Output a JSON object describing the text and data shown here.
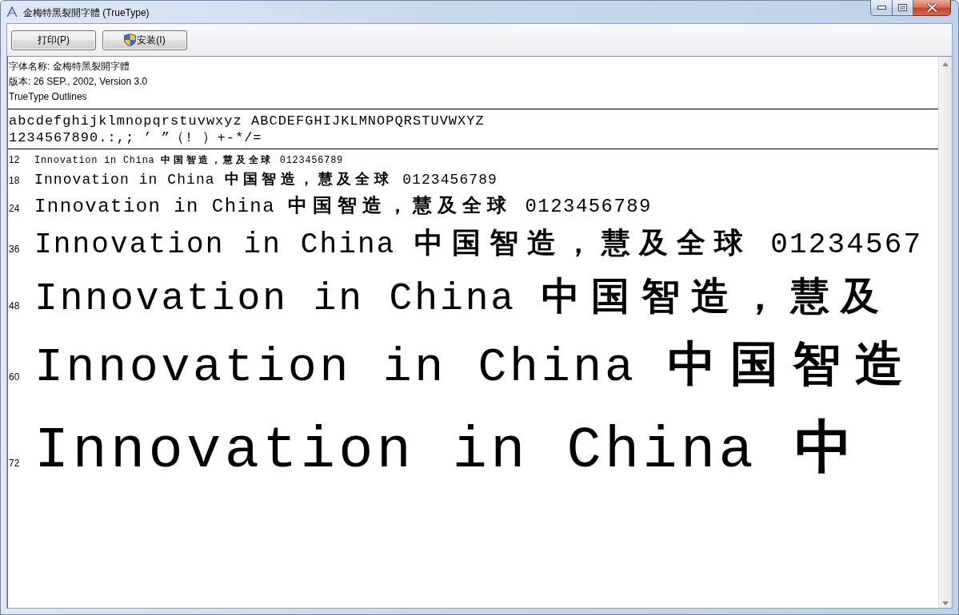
{
  "window": {
    "title": "金梅特黑裂開字體 (TrueType)"
  },
  "toolbar": {
    "buttons": [
      {
        "label": "打印(P)",
        "kind": "plain"
      },
      {
        "label": "安装(I)",
        "kind": "shield"
      }
    ]
  },
  "font_info": {
    "lines": [
      "字体名称: 金梅特黑裂開字體",
      "版本: 26 SEP., 2002, Version 3.0",
      "TrueType Outlines"
    ]
  },
  "character_set": {
    "lines": [
      "abcdefghijklmnopqrstuvwxyz ABCDEFGHIJKLMNOPQRSTUVWXYZ",
      "1234567890.:,; ’ ”（! ）+-*/="
    ]
  },
  "samples": [
    {
      "size": "12",
      "text": "Innovation in China **中国智造，慧及全球** 0123456789"
    },
    {
      "size": "18",
      "text": "Innovation in China **中国智造，慧及全球** 0123456789"
    },
    {
      "size": "24",
      "text": "Innovation in China **中国智造，慧及全球** 0123456789"
    },
    {
      "size": "36",
      "text": "Innovation in China **中国智造，慧及全球** 01234567"
    },
    {
      "size": "48",
      "text": "Innovation in China **中国智造，慧及**"
    },
    {
      "size": "60",
      "text": "Innovation in China **中国智造**"
    },
    {
      "size": "72",
      "text": "Innovation in China **中**"
    }
  ]
}
